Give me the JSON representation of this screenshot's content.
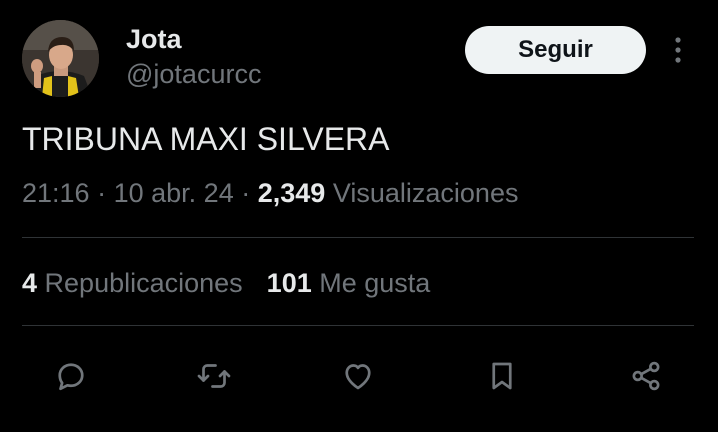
{
  "author": {
    "name": "Jota",
    "handle": "@jotacurcc"
  },
  "follow_label": "Seguir",
  "tweet": {
    "text": "TRIBUNA MAXI SILVERA",
    "time": "21:16",
    "date": "10 abr. 24",
    "views_count": "2,349",
    "views_label": "Visualizaciones",
    "separator": "·"
  },
  "stats": {
    "reposts_count": "4",
    "reposts_label": "Republicaciones",
    "likes_count": "101",
    "likes_label": "Me gusta"
  },
  "actions": [
    "reply-icon",
    "repost-icon",
    "like-icon",
    "bookmark-icon",
    "share-icon"
  ],
  "colors": {
    "background": "#000000",
    "primary_text": "#e7e9ea",
    "secondary_text": "#71767b",
    "divider": "#2f3336",
    "button_bg": "#eff3f4",
    "button_text": "#0f1419"
  }
}
